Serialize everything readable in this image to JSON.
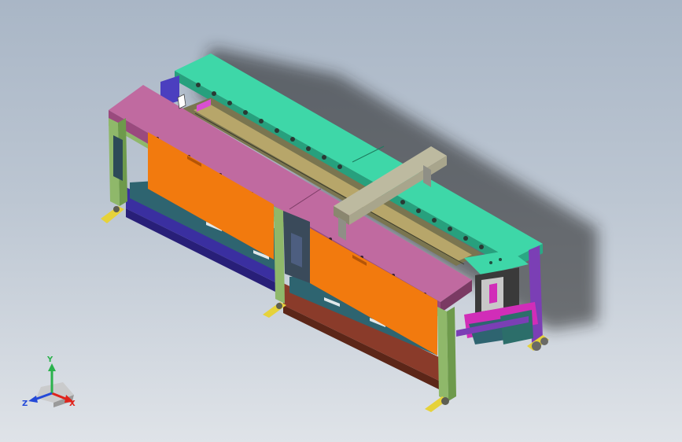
{
  "viewport": {
    "background_top": "#a9b6c6",
    "background_bottom": "#dfe3e8"
  },
  "model": {
    "colors": {
      "frame": "#8fb86a",
      "frame_dark": "#6e9a4c",
      "top_plate_front": "#b2588f",
      "top_plate_top": "#c06aa0",
      "top_plate_back": "#3ed7a8",
      "top_plate_back_dark": "#2aa884",
      "panel_orange": "#f27a0e",
      "panel_teal": "#2e6470",
      "base_blue": "#3a2fa0",
      "base_brown": "#8a3b2a",
      "gantry_beam": "#a8a58c",
      "feet": "#e6d23a",
      "purple_post": "#7b3fb5",
      "magenta": "#d12db8"
    }
  },
  "triad": {
    "x_label": "X",
    "y_label": "Y",
    "z_label": "Z",
    "x_color": "#e0231b",
    "y_color": "#2bb24c",
    "z_color": "#2449d8"
  }
}
